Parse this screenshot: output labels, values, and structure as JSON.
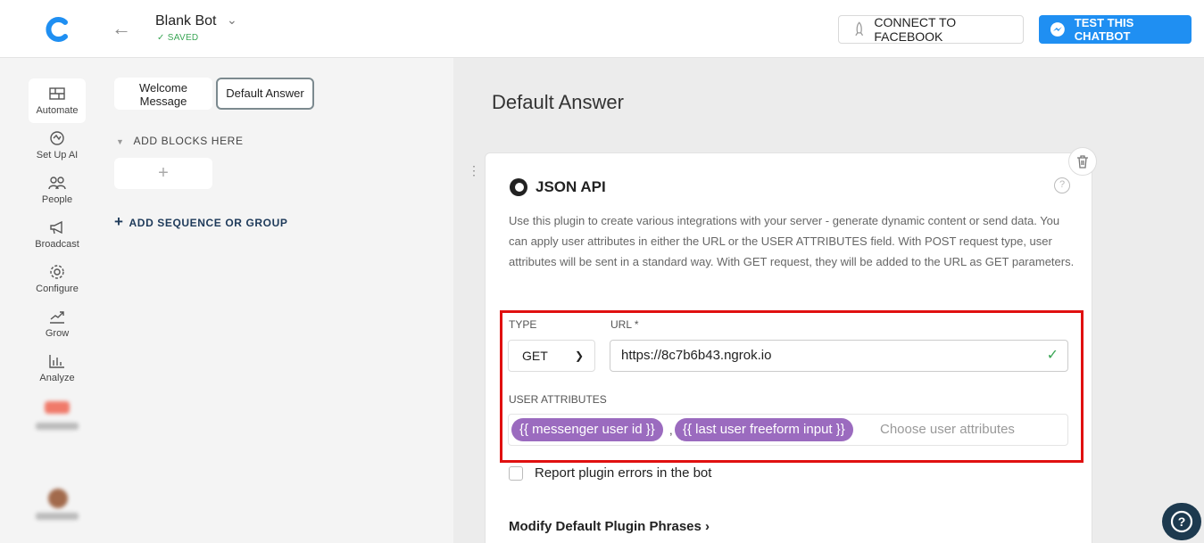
{
  "header": {
    "bot_name": "Blank Bot",
    "saved_label": "SAVED",
    "connect_label": "CONNECT TO FACEBOOK",
    "test_label": "TEST THIS CHATBOT",
    "accent_color": "#1f8ff2"
  },
  "sidebar": {
    "items": [
      {
        "label": "Automate",
        "icon": "automate-icon"
      },
      {
        "label": "Set Up AI",
        "icon": "ai-icon"
      },
      {
        "label": "People",
        "icon": "people-icon"
      },
      {
        "label": "Broadcast",
        "icon": "megaphone-icon"
      },
      {
        "label": "Configure",
        "icon": "gear-icon"
      },
      {
        "label": "Grow",
        "icon": "grow-icon"
      },
      {
        "label": "Analyze",
        "icon": "chart-icon"
      }
    ]
  },
  "blocks": {
    "welcome": "Welcome Message",
    "default": "Default Answer",
    "add_blocks": "ADD BLOCKS HERE",
    "add_plus": "+",
    "add_sequence": "ADD SEQUENCE OR GROUP"
  },
  "main": {
    "title": "Default Answer",
    "plugin_name": "JSON API",
    "description": "Use this plugin to create various integrations with your server - generate dynamic content or send data. You can apply user attributes in either the URL or the USER ATTRIBUTES field. With POST request type, user attributes will be sent in a standard way. With GET request, they will be added to the URL as GET parameters.",
    "type_label": "TYPE",
    "type_value": "GET",
    "url_label": "URL *",
    "url_value": "https://8c7b6b43.ngrok.io",
    "user_attrs_label": "USER ATTRIBUTES",
    "attrs": [
      "{{ messenger user id }}",
      "{{ last user freeform input }}"
    ],
    "attrs_separator": ",",
    "attrs_placeholder": "Choose user attributes",
    "report_errors_label": "Report plugin errors in the bot",
    "modify_phrases_label": "Modify Default Plugin Phrases",
    "help_q": "?"
  }
}
